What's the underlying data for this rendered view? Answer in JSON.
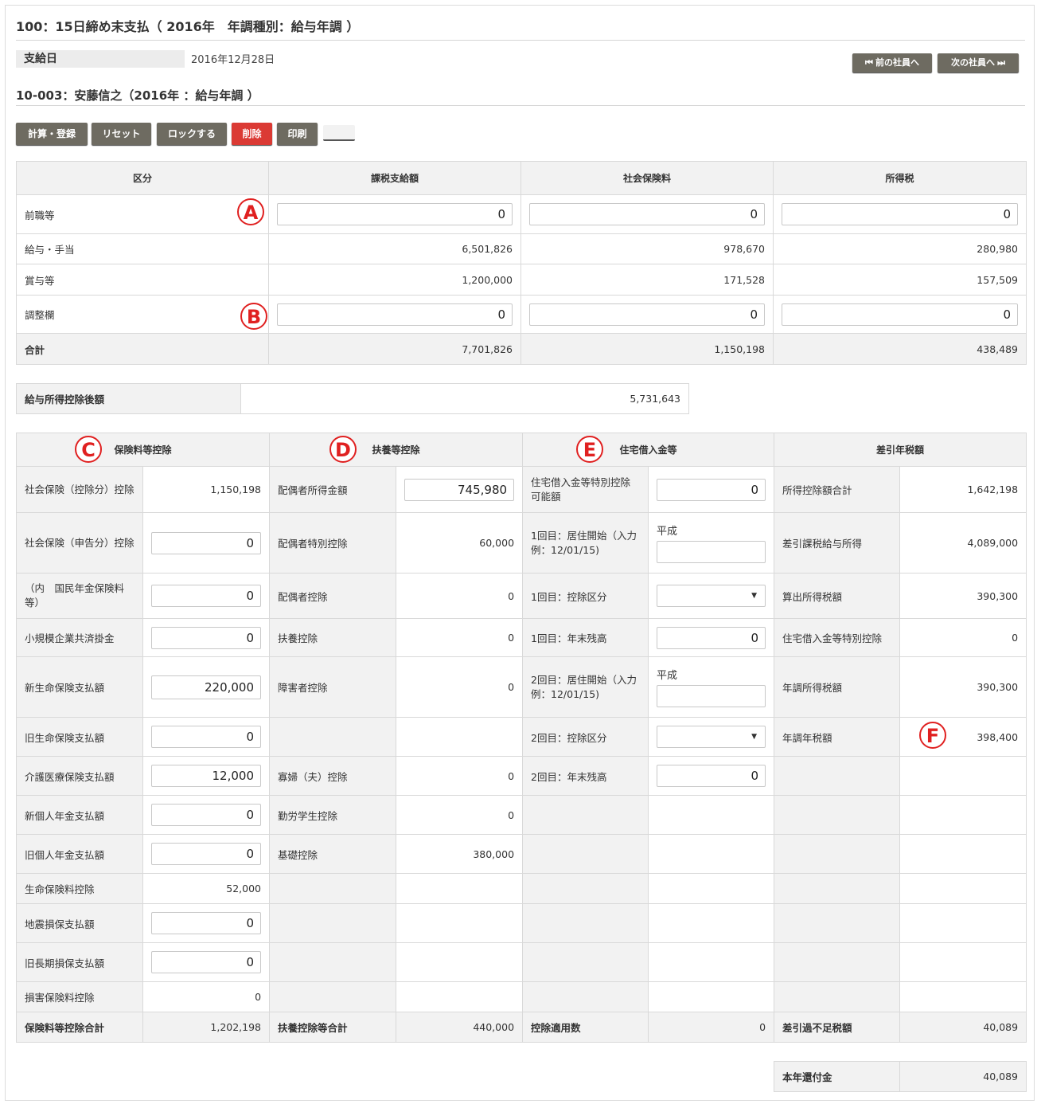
{
  "header": {
    "title": "100：15日締め末支払（ 2016年　年調種別：給与年調 ）",
    "pay_date_label": "支給日",
    "pay_date_value": "2016年12月28日",
    "prev_employee": "⏮ 前の社員へ",
    "next_employee": "次の社員へ ⏭",
    "employee_title": "10-003：安藤信之（2016年 ：給与年調 ）"
  },
  "toolbar": {
    "calc": "計算・登録",
    "reset": "リセット",
    "lock": "ロックする",
    "delete": "削除",
    "print": "印刷"
  },
  "markers": {
    "a": "A",
    "b": "B",
    "c": "C",
    "d": "D",
    "e": "E",
    "f": "F"
  },
  "summary": {
    "headers": [
      "区分",
      "課税支給額",
      "社会保険料",
      "所得税"
    ],
    "rows": [
      {
        "label": "前職等",
        "values": [
          "0",
          "0",
          "0"
        ]
      },
      {
        "label": "給与・手当",
        "values": [
          "6,501,826",
          "978,670",
          "280,980"
        ]
      },
      {
        "label": "賞与等",
        "values": [
          "1,200,000",
          "171,528",
          "157,509"
        ]
      },
      {
        "label": "調整欄",
        "values": [
          "0",
          "0",
          "0"
        ]
      },
      {
        "label": "合計",
        "values": [
          "7,701,826",
          "1,150,198",
          "438,489"
        ]
      }
    ]
  },
  "after_deduction": {
    "label": "給与所得控除後額",
    "value": "5,731,643"
  },
  "detail": {
    "headers": [
      "保険料等控除",
      "扶養等控除",
      "住宅借入金等",
      "差引年税額"
    ],
    "c": {
      "shakai_kojo_label": "社会保険（控除分）控除",
      "shakai_kojo_value": "1,150,198",
      "shakai_shinkoku_label": "社会保険（申告分）控除",
      "shakai_shinkoku_value": "0",
      "kokumin_label": "（内　国民年金保険料等）",
      "kokumin_value": "0",
      "shokibo_label": "小規模企業共済掛金",
      "shokibo_value": "0",
      "shin_seimei_label": "新生命保険支払額",
      "shin_seimei_value": "220,000",
      "kyu_seimei_label": "旧生命保険支払額",
      "kyu_seimei_value": "0",
      "kaigo_label": "介護医療保険支払額",
      "kaigo_value": "12,000",
      "shin_kojin_label": "新個人年金支払額",
      "shin_kojin_value": "0",
      "kyu_kojin_label": "旧個人年金支払額",
      "kyu_kojin_value": "0",
      "seimei_kojo_label": "生命保険料控除",
      "seimei_kojo_value": "52,000",
      "jishin_label": "地震損保支払額",
      "jishin_value": "0",
      "kyu_choki_label": "旧長期損保支払額",
      "kyu_choki_value": "0",
      "songai_kojo_label": "損害保険料控除",
      "songai_kojo_value": "0",
      "total_label": "保険料等控除合計",
      "total_value": "1,202,198"
    },
    "d": {
      "haigusha_shotoku_label": "配偶者所得金額",
      "haigusha_shotoku_value": "745,980",
      "haigusha_tokubetsu_label": "配偶者特別控除",
      "haigusha_tokubetsu_value": "60,000",
      "haigusha_kojo_label": "配偶者控除",
      "haigusha_kojo_value": "0",
      "fuyo_label": "扶養控除",
      "fuyo_value": "0",
      "shogai_label": "障害者控除",
      "shogai_value": "0",
      "kafu_label": "寡婦（夫）控除",
      "kafu_value": "0",
      "kinro_label": "勤労学生控除",
      "kinro_value": "0",
      "kiso_label": "基礎控除",
      "kiso_value": "380,000",
      "total_label": "扶養控除等合計",
      "total_value": "440,000"
    },
    "e": {
      "kanogaku_label": "住宅借入金等特別控除可能額",
      "kanogaku_value": "0",
      "start1_label": "1回目：居住開始（入力例：12/01/15)",
      "start1_era": "平成",
      "kubun1_label": "1回目：控除区分",
      "zandaka1_label": "1回目：年末残高",
      "zandaka1_value": "0",
      "start2_label": "2回目：居住開始（入力例：12/01/15)",
      "start2_era": "平成",
      "kubun2_label": "2回目：控除区分",
      "zandaka2_label": "2回目：年末残高",
      "zandaka2_value": "0",
      "count_label": "控除適用数",
      "count_value": "0"
    },
    "f": {
      "kojo_total_label": "所得控除額合計",
      "kojo_total_value": "1,642,198",
      "kazei_label": "差引課税給与所得",
      "kazei_value": "4,089,000",
      "sanshutsu_label": "算出所得税額",
      "sanshutsu_value": "390,300",
      "jutaku_label": "住宅借入金等特別控除",
      "jutaku_value": "0",
      "nencho_shotoku_label": "年調所得税額",
      "nencho_shotoku_value": "390,300",
      "nencho_nenzei_label": "年調年税額",
      "nencho_nenzei_value": "398,400",
      "kabusoku_label": "差引過不足税額",
      "kabusoku_value": "40,089"
    }
  },
  "refund": {
    "label": "本年還付金",
    "value": "40,089"
  }
}
